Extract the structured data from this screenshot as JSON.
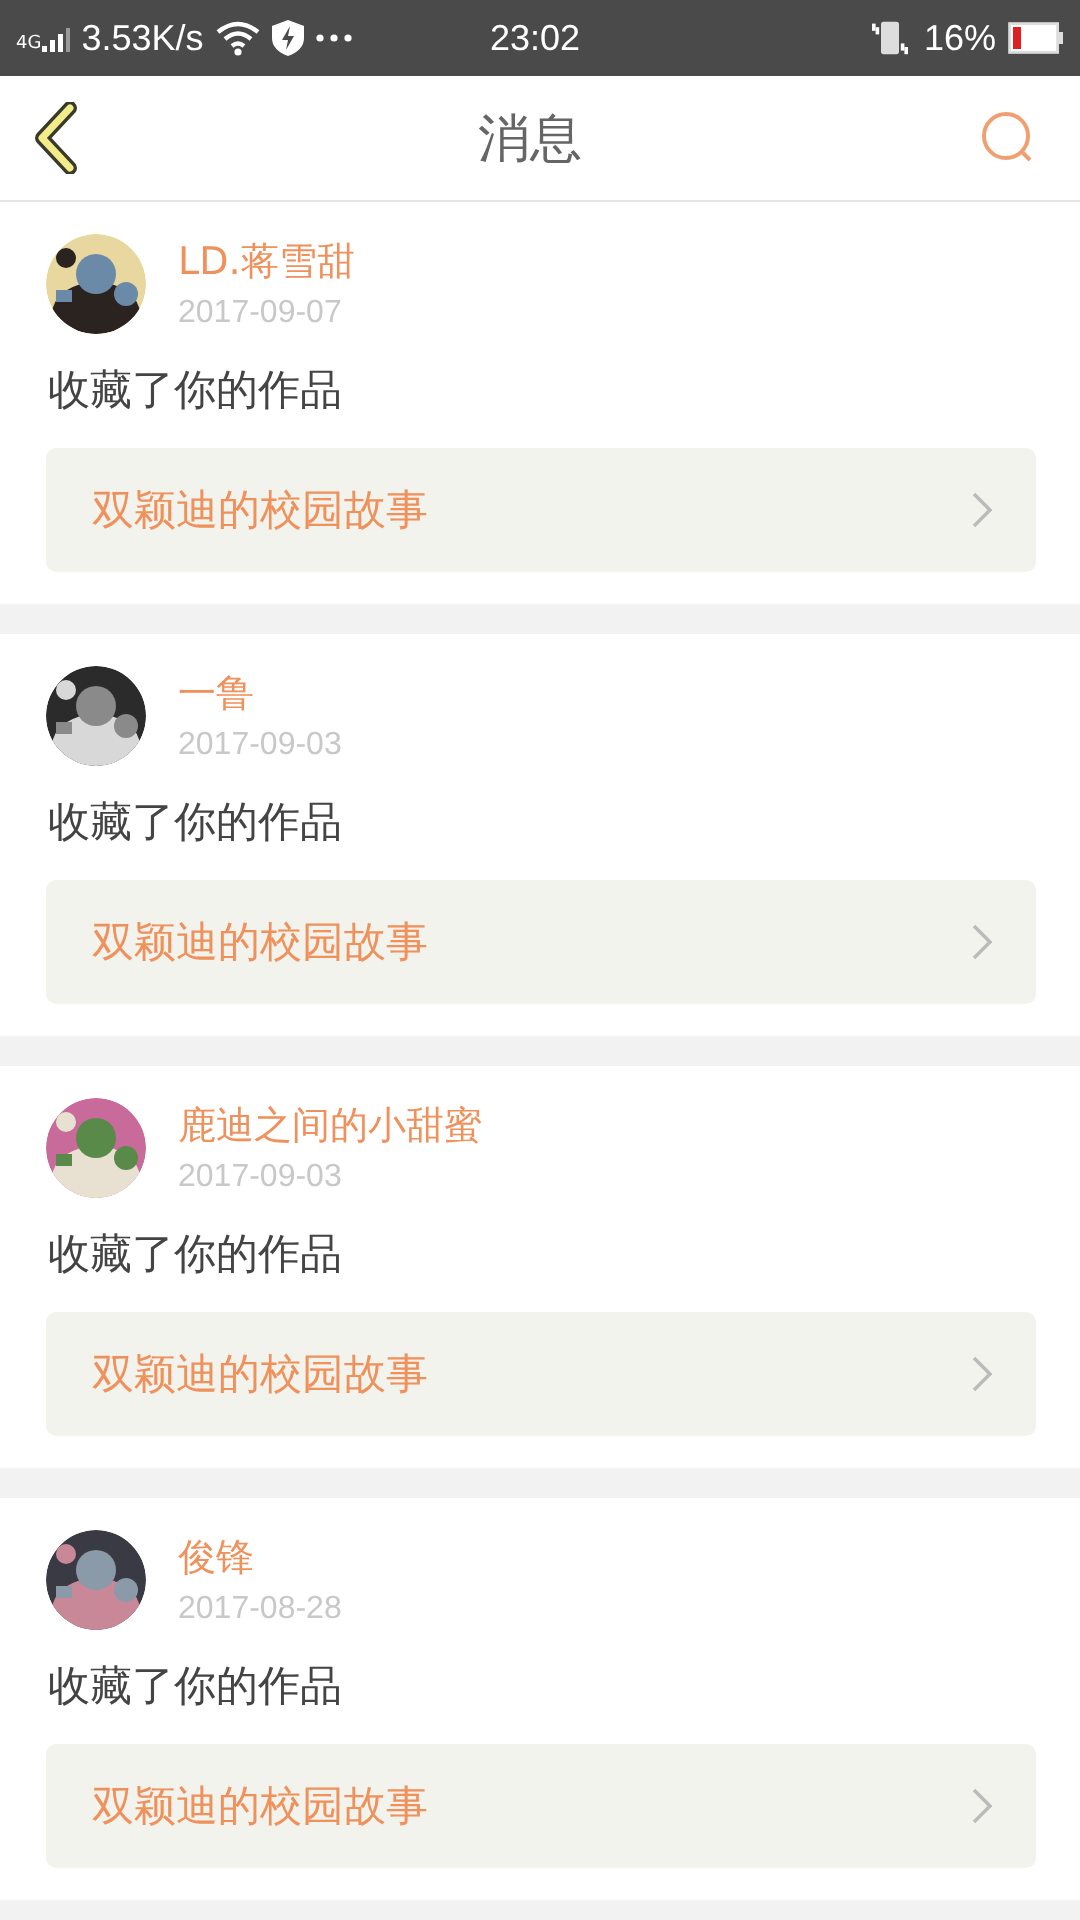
{
  "status_bar": {
    "network": "4G",
    "speed": "3.53K/s",
    "time": "23:02",
    "battery": "16%"
  },
  "header": {
    "title": "消息"
  },
  "messages": [
    {
      "user": "LD.蒋雪甜",
      "date": "2017-09-07",
      "action": "收藏了你的作品",
      "work": "双颖迪的校园故事"
    },
    {
      "user": "一鲁",
      "date": "2017-09-03",
      "action": "收藏了你的作品",
      "work": "双颖迪的校园故事"
    },
    {
      "user": "鹿迪之间的小甜蜜",
      "date": "2017-09-03",
      "action": "收藏了你的作品",
      "work": "双颖迪的校园故事"
    },
    {
      "user": "俊锋",
      "date": "2017-08-28",
      "action": "收藏了你的作品",
      "work": "双颖迪的校园故事"
    }
  ]
}
